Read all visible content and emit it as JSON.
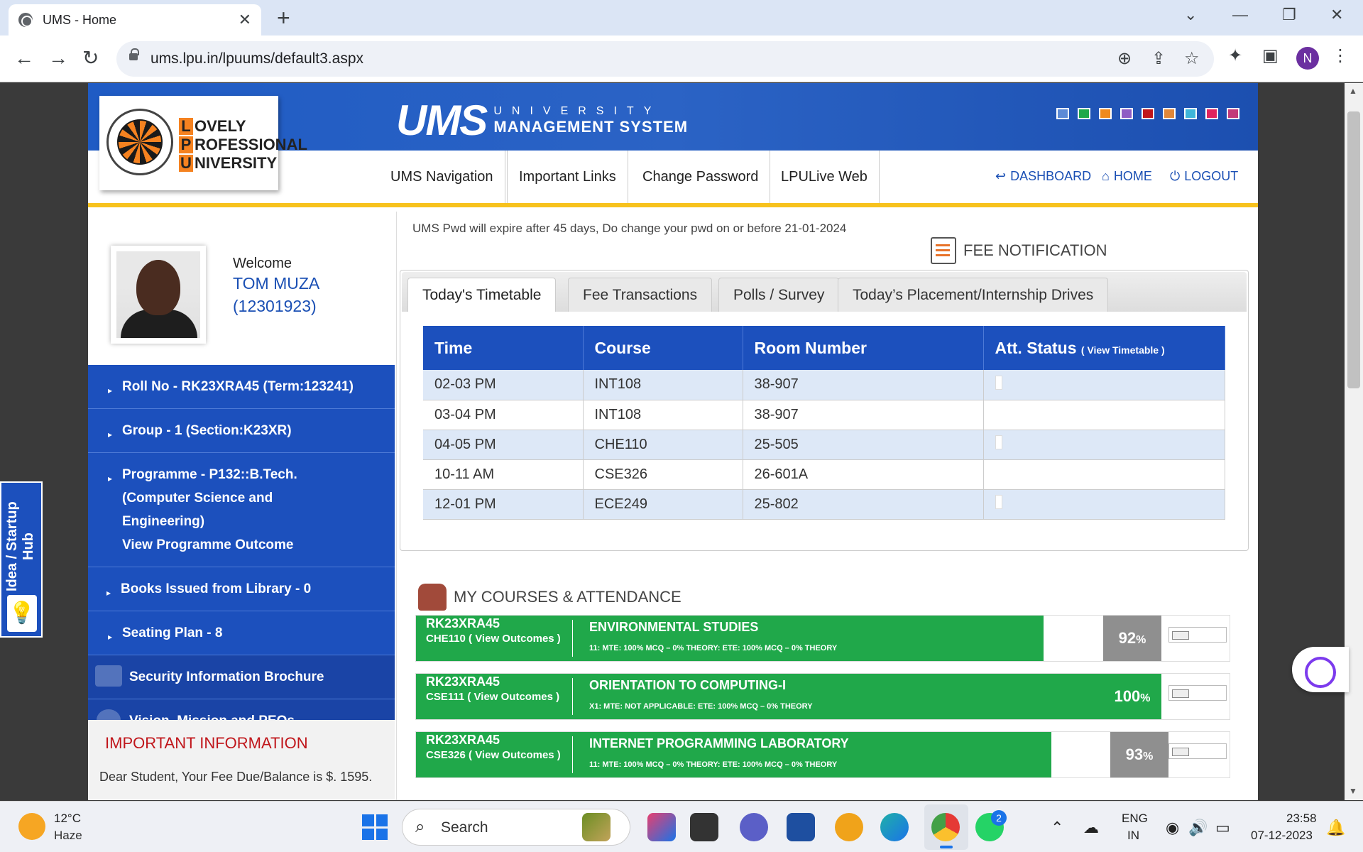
{
  "browser": {
    "tab_title": "UMS - Home",
    "tab_close": "✕",
    "new_tab": "+",
    "url": "ums.lpu.in/lpuums/default3.aspx",
    "profile_initial": "N"
  },
  "header": {
    "lpu_lines": [
      {
        "letter": "L",
        "rest": "OVELY"
      },
      {
        "letter": "P",
        "rest": "ROFESSIONAL"
      },
      {
        "letter": "U",
        "rest": "NIVERSITY"
      }
    ],
    "ums_word": "UMS",
    "ums_sub_1": "UNIVERSITY",
    "ums_sub_2": "MANAGEMENT SYSTEM",
    "theme_colors": [
      "#5c8ad6",
      "#1fa84a",
      "#f08a1e",
      "#8e5cc4",
      "#c0161b",
      "#e0873a",
      "#3fb6d9",
      "#e0245e",
      "#c23a7a"
    ]
  },
  "nav": {
    "items": [
      "UMS Navigation",
      "Important Links",
      "Change Password",
      "LPULive Web"
    ],
    "dashboard": "DASHBOARD",
    "home": "HOME",
    "logout": "LOGOUT"
  },
  "profile": {
    "welcome": "Welcome",
    "name": "TOM MUZA",
    "id": "(12301923)"
  },
  "sidebar": {
    "roll": "Roll No - RK23XRA45 (Term:123241)",
    "group": "Group - 1 (Section:K23XR)",
    "programme_1": "Programme - P132::B.Tech.",
    "programme_2": "(Computer Science and",
    "programme_3": "Engineering)",
    "programme_outcome": "View Programme Outcome",
    "books": "Books Issued from Library - 0",
    "seating": "Seating Plan - 8",
    "security": "Security Information Brochure",
    "vision": "Vision, Mission and PEOs"
  },
  "important": {
    "title": "IMPORTANT INFORMATION",
    "text": "Dear Student, Your Fee Due/Balance is $. 1595."
  },
  "main": {
    "pwd_note": "UMS Pwd will expire after 45 days, Do change your pwd on or before 21-01-2024",
    "fee_notification": "FEE NOTIFICATION",
    "tabs": [
      "Today's Timetable",
      "Fee Transactions",
      "Polls / Survey",
      "Today’s Placement/Internship Drives"
    ],
    "timetable": {
      "headers": [
        "Time",
        "Course",
        "Room Number",
        "Att. Status"
      ],
      "view_timetable": "( View Timetable )",
      "rows": [
        {
          "time": "02-03 PM",
          "course": "INT108",
          "room": "38-907"
        },
        {
          "time": "03-04 PM",
          "course": "INT108",
          "room": "38-907"
        },
        {
          "time": "04-05 PM",
          "course": "CHE110",
          "room": "25-505"
        },
        {
          "time": "10-11 AM",
          "course": "CSE326",
          "room": "26-601A"
        },
        {
          "time": "12-01 PM",
          "course": "ECE249",
          "room": "25-802"
        }
      ]
    },
    "courses_title": "MY COURSES & ATTENDANCE",
    "courses": [
      {
        "roll": "RK23XRA45",
        "code": "CHE110 ( View Outcomes )",
        "name": "ENVIRONMENTAL STUDIES",
        "desc": "11: MTE: 100% MCQ – 0% THEORY: ETE: 100% MCQ – 0% THEORY",
        "pct": "92",
        "pct_sign": "%",
        "attendance": 0.92
      },
      {
        "roll": "RK23XRA45",
        "code": "CSE111 ( View Outcomes )",
        "name": "ORIENTATION TO COMPUTING-I",
        "desc": "X1: MTE: NOT APPLICABLE: ETE: 100% MCQ – 0% THEORY",
        "pct": "100",
        "pct_sign": "%",
        "attendance": 1.0
      },
      {
        "roll": "RK23XRA45",
        "code": "CSE326 ( View Outcomes )",
        "name": "INTERNET PROGRAMMING LABORATORY",
        "desc": "11: MTE: 100% MCQ – 0% THEORY: ETE: 100% MCQ – 0% THEORY",
        "pct": "93",
        "pct_sign": "%",
        "attendance": 0.93
      }
    ]
  },
  "startup": {
    "label": "Idea / Startup Hub"
  },
  "taskbar": {
    "temp": "12°C",
    "weather": "Haze",
    "search": "Search",
    "whatsapp_badge": "2",
    "lang_1": "ENG",
    "lang_2": "IN",
    "time": "23:58",
    "date": "07-12-2023"
  }
}
